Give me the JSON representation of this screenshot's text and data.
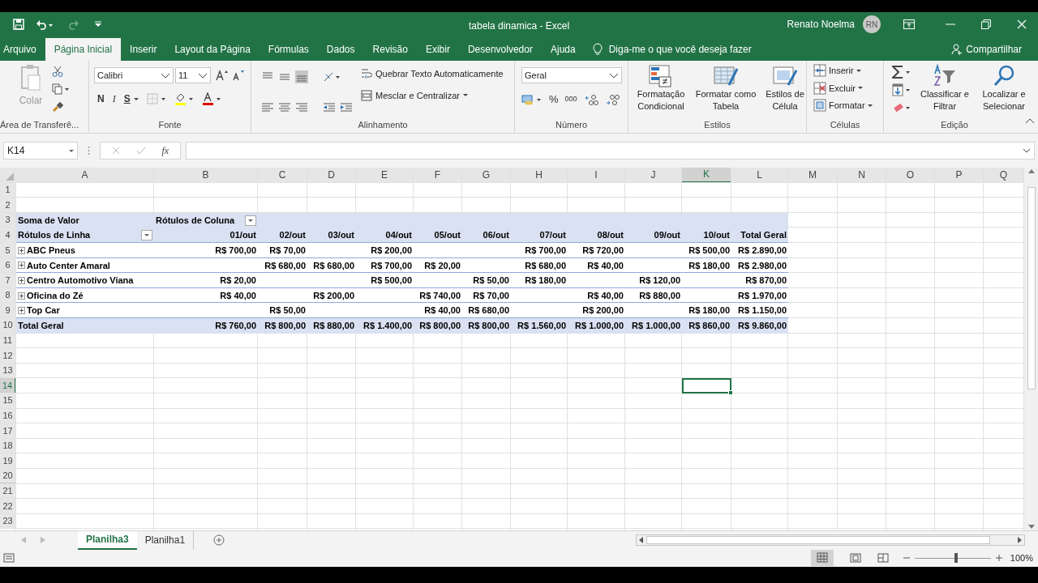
{
  "window": {
    "title": "tabela dinamica  -  Excel",
    "user": "Renato Noelma",
    "initials": "RN"
  },
  "ribbon_tabs": [
    {
      "label": "Arquivo",
      "selected": false
    },
    {
      "label": "Página Inicial",
      "selected": true
    },
    {
      "label": "Inserir",
      "selected": false
    },
    {
      "label": "Layout da Página",
      "selected": false
    },
    {
      "label": "Fórmulas",
      "selected": false
    },
    {
      "label": "Dados",
      "selected": false
    },
    {
      "label": "Revisão",
      "selected": false
    },
    {
      "label": "Exibir",
      "selected": false
    },
    {
      "label": "Desenvolvedor",
      "selected": false
    },
    {
      "label": "Ajuda",
      "selected": false
    }
  ],
  "tell_me": "Diga-me o que você deseja fazer",
  "share": "Compartilhar",
  "ribbon": {
    "clipboard": {
      "paste": "Colar",
      "disabled": true,
      "label": "Área de Transferê..."
    },
    "font": {
      "name": "Calibri",
      "size": "11",
      "bold": "N",
      "italic": "I",
      "underline": "S",
      "label": "Fonte"
    },
    "alignment": {
      "wrap": "Quebrar Texto Automaticamente",
      "merge": "Mesclar e Centralizar",
      "label": "Alinhamento"
    },
    "number": {
      "format": "Geral",
      "percent": "%",
      "thousands": "000",
      "label": "Número"
    },
    "styles": {
      "buttons": [
        "Formatação Condicional",
        "Formatar como Tabela",
        "Estilos de Célula"
      ],
      "label": "Estilos"
    },
    "cells": {
      "buttons": [
        "Inserir",
        "Excluir",
        "Formatar"
      ],
      "label": "Células"
    },
    "editing": {
      "buttons": [
        "Classificar e Filtrar",
        "Localizar e Selecionar"
      ],
      "label": "Edição"
    }
  },
  "formula_bar": {
    "name_box": "K14",
    "function_label": "fx"
  },
  "columns": [
    {
      "label": "A",
      "selected": false
    },
    {
      "label": "B",
      "selected": false
    },
    {
      "label": "C",
      "selected": false
    },
    {
      "label": "D",
      "selected": false
    },
    {
      "label": "E",
      "selected": false
    },
    {
      "label": "F",
      "selected": false
    },
    {
      "label": "G",
      "selected": false
    },
    {
      "label": "H",
      "selected": false
    },
    {
      "label": "I",
      "selected": false
    },
    {
      "label": "J",
      "selected": false
    },
    {
      "label": "K",
      "selected": true
    },
    {
      "label": "L",
      "selected": false
    },
    {
      "label": "M",
      "selected": false
    },
    {
      "label": "N",
      "selected": false
    },
    {
      "label": "O",
      "selected": false
    },
    {
      "label": "P",
      "selected": false
    },
    {
      "label": "Q",
      "selected": false
    }
  ],
  "rows": [
    {
      "label": "1",
      "selected": false
    },
    {
      "label": "2",
      "selected": false
    },
    {
      "label": "3",
      "selected": false
    },
    {
      "label": "4",
      "selected": false
    },
    {
      "label": "5",
      "selected": false
    },
    {
      "label": "6",
      "selected": false
    },
    {
      "label": "7",
      "selected": false
    },
    {
      "label": "8",
      "selected": false
    },
    {
      "label": "9",
      "selected": false
    },
    {
      "label": "10",
      "selected": false
    },
    {
      "label": "11",
      "selected": false
    },
    {
      "label": "12",
      "selected": false
    },
    {
      "label": "13",
      "selected": false
    },
    {
      "label": "14",
      "selected": true
    },
    {
      "label": "15",
      "selected": false
    },
    {
      "label": "16",
      "selected": false
    },
    {
      "label": "17",
      "selected": false
    },
    {
      "label": "18",
      "selected": false
    },
    {
      "label": "19",
      "selected": false
    },
    {
      "label": "20",
      "selected": false
    },
    {
      "label": "21",
      "selected": false
    },
    {
      "label": "22",
      "selected": false
    },
    {
      "label": "23",
      "selected": false
    }
  ],
  "pivot": {
    "value_label": "Soma de Valor",
    "column_labels": "Rótulos de Coluna",
    "row_labels": "Rótulos de Linha",
    "dates": [
      "01/out",
      "02/out",
      "03/out",
      "04/out",
      "05/out",
      "06/out",
      "07/out",
      "08/out",
      "09/out",
      "10/out"
    ],
    "total_header": "Total Geral",
    "rows": [
      {
        "label": "ABC Pneus",
        "expanded": false,
        "values": [
          {
            "kind": "amount",
            "value": "R$ 700,00"
          },
          {
            "kind": "amount",
            "value": "R$ 70,00"
          },
          {
            "kind": "blank"
          },
          {
            "kind": "amount",
            "value": "R$ 200,00"
          },
          {
            "kind": "blank"
          },
          {
            "kind": "blank"
          },
          {
            "kind": "amount",
            "value": "R$ 700,00"
          },
          {
            "kind": "amount",
            "value": "R$ 720,00"
          },
          {
            "kind": "blank"
          },
          {
            "kind": "amount",
            "value": "R$ 500,00"
          }
        ],
        "total": "R$ 2.890,00"
      },
      {
        "label": "Auto Center Amaral",
        "expanded": false,
        "values": [
          {
            "kind": "blank"
          },
          {
            "kind": "amount",
            "value": "R$ 680,00"
          },
          {
            "kind": "amount",
            "value": "R$ 680,00"
          },
          {
            "kind": "amount",
            "value": "R$ 700,00"
          },
          {
            "kind": "amount",
            "value": "R$ 20,00"
          },
          {
            "kind": "blank"
          },
          {
            "kind": "amount",
            "value": "R$ 680,00"
          },
          {
            "kind": "amount",
            "value": "R$ 40,00"
          },
          {
            "kind": "blank"
          },
          {
            "kind": "amount",
            "value": "R$ 180,00"
          }
        ],
        "total": "R$ 2.980,00"
      },
      {
        "label": "Centro Automotivo Viana",
        "expanded": false,
        "values": [
          {
            "kind": "amount",
            "value": "R$ 20,00"
          },
          {
            "kind": "blank"
          },
          {
            "kind": "blank"
          },
          {
            "kind": "amount",
            "value": "R$ 500,00"
          },
          {
            "kind": "blank"
          },
          {
            "kind": "amount",
            "value": "R$ 50,00"
          },
          {
            "kind": "amount",
            "value": "R$ 180,00"
          },
          {
            "kind": "blank"
          },
          {
            "kind": "amount",
            "value": "R$ 120,00"
          },
          {
            "kind": "blank"
          }
        ],
        "total": "R$ 870,00"
      },
      {
        "label": "Oficina do Zé",
        "expanded": false,
        "values": [
          {
            "kind": "amount",
            "value": "R$ 40,00"
          },
          {
            "kind": "blank"
          },
          {
            "kind": "amount",
            "value": "R$ 200,00"
          },
          {
            "kind": "blank"
          },
          {
            "kind": "amount",
            "value": "R$ 740,00"
          },
          {
            "kind": "amount",
            "value": "R$ 70,00"
          },
          {
            "kind": "blank"
          },
          {
            "kind": "amount",
            "value": "R$ 40,00"
          },
          {
            "kind": "amount",
            "value": "R$ 880,00"
          },
          {
            "kind": "blank"
          }
        ],
        "total": "R$ 1.970,00"
      },
      {
        "label": "Top Car",
        "expanded": false,
        "values": [
          {
            "kind": "blank"
          },
          {
            "kind": "amount",
            "value": "R$ 50,00"
          },
          {
            "kind": "blank"
          },
          {
            "kind": "blank"
          },
          {
            "kind": "amount",
            "value": "R$ 40,00"
          },
          {
            "kind": "amount",
            "value": "R$ 680,00"
          },
          {
            "kind": "blank"
          },
          {
            "kind": "amount",
            "value": "R$ 200,00"
          },
          {
            "kind": "blank"
          },
          {
            "kind": "amount",
            "value": "R$ 180,00"
          }
        ],
        "total": "R$ 1.150,00"
      }
    ],
    "grand_total": {
      "label": "Total Geral",
      "values": [
        {
          "kind": "amount",
          "value": "R$ 760,00"
        },
        {
          "kind": "amount",
          "value": "R$ 800,00"
        },
        {
          "kind": "amount",
          "value": "R$ 880,00"
        },
        {
          "kind": "amount",
          "value": "R$ 1.400,00"
        },
        {
          "kind": "amount",
          "value": "R$ 800,00"
        },
        {
          "kind": "amount",
          "value": "R$ 800,00"
        },
        {
          "kind": "amount",
          "value": "R$ 1.560,00"
        },
        {
          "kind": "amount",
          "value": "R$ 1.000,00"
        },
        {
          "kind": "amount",
          "value": "R$ 1.000,00"
        },
        {
          "kind": "amount",
          "value": "R$ 860,00"
        }
      ],
      "total": "R$ 9.860,00"
    }
  },
  "sheet_tabs": [
    {
      "label": "Planilha3",
      "selected": true
    },
    {
      "label": "Planilha1",
      "selected": false
    }
  ],
  "zoom": {
    "label": "100%",
    "level": 0.55
  }
}
